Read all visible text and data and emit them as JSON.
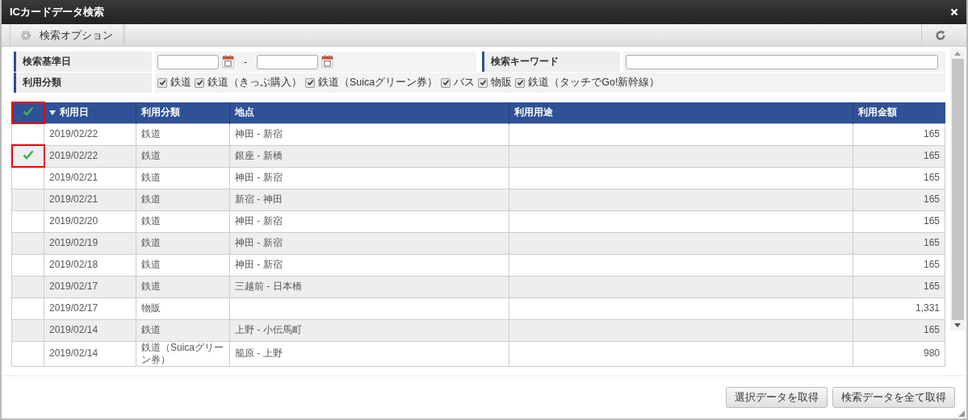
{
  "window": {
    "title": "ICカードデータ検索"
  },
  "toolbar": {
    "tab": "検索オプション"
  },
  "search_form": {
    "date_label": "検索基準日",
    "range_separator": "-",
    "keyword_label": "検索キーワード",
    "category_label": "利用分類",
    "categories": [
      {
        "label": "鉄道",
        "checked": true
      },
      {
        "label": "鉄道（きっぷ購入）",
        "checked": true
      },
      {
        "label": "鉄道（Suicaグリーン券）",
        "checked": true
      },
      {
        "label": "バス",
        "checked": true
      },
      {
        "label": "物販",
        "checked": true
      },
      {
        "label": "鉄道（タッチでGo!新幹線）",
        "checked": true
      }
    ]
  },
  "table": {
    "select_all": {
      "checked": true,
      "highlighted": true
    },
    "columns": [
      {
        "label": "利用日",
        "sorted": true
      },
      {
        "label": "利用分類",
        "sorted": false
      },
      {
        "label": "地点",
        "sorted": false
      },
      {
        "label": "利用用途",
        "sorted": false
      },
      {
        "label": "利用金額",
        "sorted": false
      }
    ],
    "rows": [
      {
        "checked": false,
        "highlighted": false,
        "date": "2019/02/22",
        "category": "鉄道",
        "place": "神田 - 新宿",
        "purpose": "",
        "amount": "165"
      },
      {
        "checked": true,
        "highlighted": true,
        "date": "2019/02/22",
        "category": "鉄道",
        "place": "銀座 - 新橋",
        "purpose": "",
        "amount": "165"
      },
      {
        "checked": false,
        "highlighted": false,
        "date": "2019/02/21",
        "category": "鉄道",
        "place": "神田 - 新宿",
        "purpose": "",
        "amount": "165"
      },
      {
        "checked": false,
        "highlighted": false,
        "date": "2019/02/21",
        "category": "鉄道",
        "place": "新宿 - 神田",
        "purpose": "",
        "amount": "165"
      },
      {
        "checked": false,
        "highlighted": false,
        "date": "2019/02/20",
        "category": "鉄道",
        "place": "神田 - 新宿",
        "purpose": "",
        "amount": "165"
      },
      {
        "checked": false,
        "highlighted": false,
        "date": "2019/02/19",
        "category": "鉄道",
        "place": "神田 - 新宿",
        "purpose": "",
        "amount": "165"
      },
      {
        "checked": false,
        "highlighted": false,
        "date": "2019/02/18",
        "category": "鉄道",
        "place": "神田 - 新宿",
        "purpose": "",
        "amount": "165"
      },
      {
        "checked": false,
        "highlighted": false,
        "date": "2019/02/17",
        "category": "鉄道",
        "place": "三越前 - 日本橋",
        "purpose": "",
        "amount": "165"
      },
      {
        "checked": false,
        "highlighted": false,
        "date": "2019/02/17",
        "category": "物販",
        "place": "",
        "purpose": "",
        "amount": "1,331"
      },
      {
        "checked": false,
        "highlighted": false,
        "date": "2019/02/14",
        "category": "鉄道",
        "place": "上野 - 小伝馬町",
        "purpose": "",
        "amount": "165"
      },
      {
        "checked": false,
        "highlighted": false,
        "date": "2019/02/14",
        "category": "鉄道（Suicaグリーン券）",
        "place": "籠原 - 上野",
        "purpose": "",
        "amount": "980"
      }
    ]
  },
  "buttons": [
    {
      "label": "選択データを取得"
    },
    {
      "label": "検索データを全て取得"
    }
  ]
}
